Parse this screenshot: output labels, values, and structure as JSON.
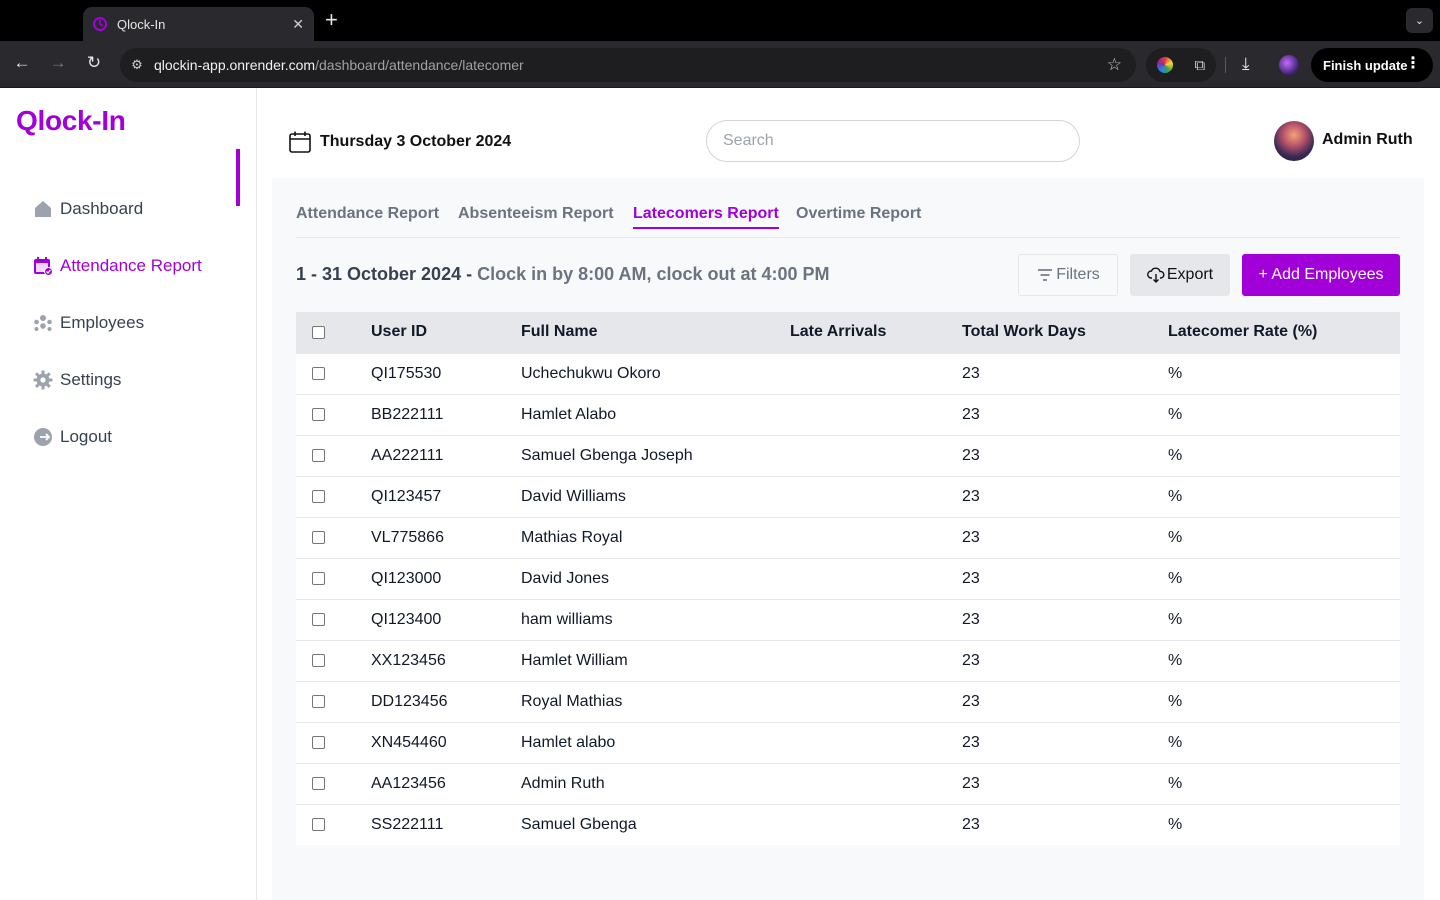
{
  "browser": {
    "tab_title": "Qlock-In",
    "url_host": "qlockin-app.onrender.com",
    "url_path": "/dashboard/attendance/latecomer",
    "finish_update": "Finish update"
  },
  "sidebar": {
    "logo": "Qlock-In",
    "items": [
      {
        "label": "Dashboard",
        "icon": "home-icon"
      },
      {
        "label": "Attendance Report",
        "icon": "calendar-check-icon"
      },
      {
        "label": "Employees",
        "icon": "people-icon"
      },
      {
        "label": "Settings",
        "icon": "gear-icon"
      },
      {
        "label": "Logout",
        "icon": "logout-icon"
      }
    ],
    "active_index": 1
  },
  "header": {
    "date": "Thursday 3 October 2024",
    "search_placeholder": "Search",
    "user_name": "Admin Ruth"
  },
  "report_tabs": {
    "items": [
      "Attendance Report",
      "Absenteeism Report",
      "Latecomers Report",
      "Overtime Report"
    ],
    "active_index": 2
  },
  "toolbar": {
    "period": "1 - 31 October 2024 -",
    "period_sub": "Clock in by 8:00 AM, clock out at 4:00 PM",
    "filters_label": "Filters",
    "export_label": "Export",
    "add_label": "+ Add Employees"
  },
  "table": {
    "columns": [
      "User ID",
      "Full Name",
      "Late Arrivals",
      "Total Work Days",
      "Latecomer Rate (%)"
    ],
    "rows": [
      [
        "QI175530",
        "Uchechukwu Okoro",
        "",
        "23",
        "%"
      ],
      [
        "BB222111",
        "Hamlet Alabo",
        "",
        "23",
        "%"
      ],
      [
        "AA222111",
        "Samuel Gbenga Joseph",
        "",
        "23",
        "%"
      ],
      [
        "QI123457",
        "David Williams",
        "",
        "23",
        "%"
      ],
      [
        "VL775866",
        "Mathias Royal",
        "",
        "23",
        "%"
      ],
      [
        "QI123000",
        "David Jones",
        "",
        "23",
        "%"
      ],
      [
        "QI123400",
        "ham williams",
        "",
        "23",
        "%"
      ],
      [
        "XX123456",
        "Hamlet William",
        "",
        "23",
        "%"
      ],
      [
        "DD123456",
        "Royal Mathias",
        "",
        "23",
        "%"
      ],
      [
        "XN454460",
        "Hamlet alabo",
        "",
        "23",
        "%"
      ],
      [
        "AA123456",
        "Admin Ruth",
        "",
        "23",
        "%"
      ],
      [
        "SS222111",
        "Samuel Gbenga",
        "",
        "23",
        "%"
      ]
    ]
  },
  "colors": {
    "accent": "#a100d9",
    "header_bg": "#e5e7eb",
    "content_bg": "#f8f9fb"
  }
}
